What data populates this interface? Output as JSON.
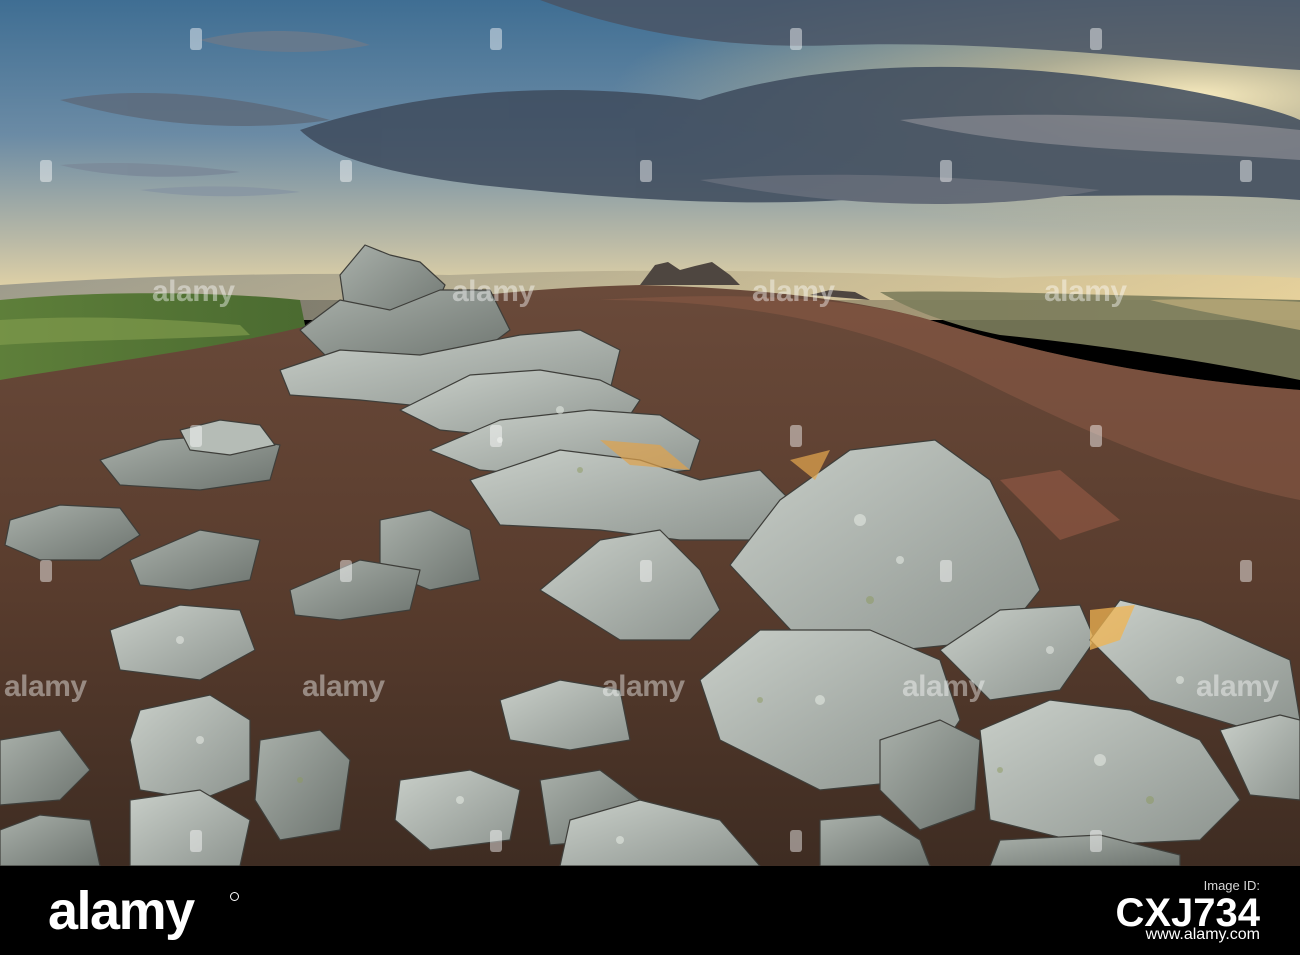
{
  "watermark": {
    "text": "alamy"
  },
  "footer": {
    "brand": "alamy",
    "stock_label": "Image ID:",
    "stock_id": "CXJ734",
    "url": "www.alamy.com"
  }
}
